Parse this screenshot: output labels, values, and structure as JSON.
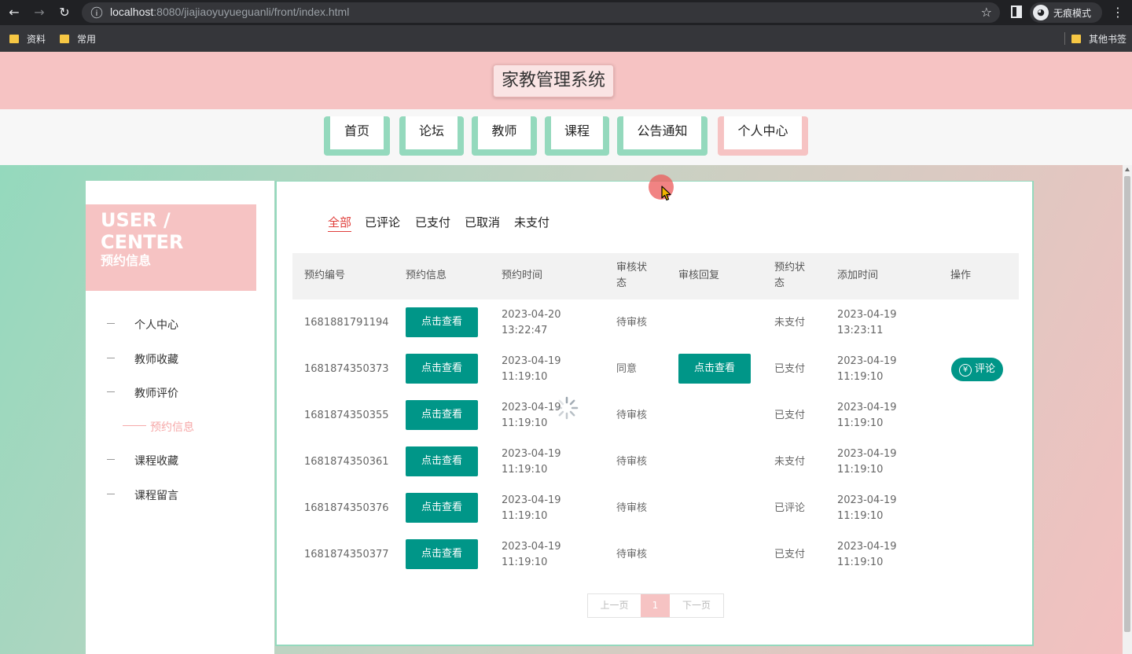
{
  "browser": {
    "url_host": "localhost",
    "url_rest": ":8080/jiajiaoyuyueguanli/front/index.html",
    "incognito_label": "无痕模式",
    "bookmarks": [
      "资料",
      "常用"
    ],
    "other_bookmarks": "其他书签"
  },
  "site": {
    "title": "家教管理系统"
  },
  "nav": [
    "首页",
    "论坛",
    "教师",
    "课程",
    "公告通知",
    "个人中心"
  ],
  "sidebar": {
    "en_title": "USER / CENTER",
    "cn_title": "预约信息",
    "items": [
      "个人中心",
      "教师收藏",
      "教师评价",
      "预约信息",
      "课程收藏",
      "课程留言"
    ],
    "active_index": 3
  },
  "tabs": [
    "全部",
    "已评论",
    "已支付",
    "已取消",
    "未支付"
  ],
  "table": {
    "headers": {
      "id": "预约编号",
      "info": "预约信息",
      "time": "预约时间",
      "audit_status_1": "审核状",
      "audit_status_2": "态",
      "audit_reply": "审核回复",
      "booking_status_1": "预约状",
      "booking_status_2": "态",
      "added": "添加时间",
      "ops": "操作"
    },
    "view_label": "点击查看",
    "comment_label": "评论",
    "yen_icon": "¥",
    "rows": [
      {
        "id": "1681881791194",
        "date": "2023-04-20",
        "time": "13:22:47",
        "audit": "待审核",
        "status": "未支付",
        "add_date": "2023-04-19",
        "add_time": "13:23:11"
      },
      {
        "id": "1681874350373",
        "date": "2023-04-19",
        "time": "11:19:10",
        "audit": "同意",
        "status": "已支付",
        "add_date": "2023-04-19",
        "add_time": "11:19:10"
      },
      {
        "id": "1681874350355",
        "date": "2023-04-19",
        "time": "11:19:10",
        "audit": "待审核",
        "status": "已支付",
        "add_date": "2023-04-19",
        "add_time": "11:19:10"
      },
      {
        "id": "1681874350361",
        "date": "2023-04-19",
        "time": "11:19:10",
        "audit": "待审核",
        "status": "未支付",
        "add_date": "2023-04-19",
        "add_time": "11:19:10"
      },
      {
        "id": "1681874350376",
        "date": "2023-04-19",
        "time": "11:19:10",
        "audit": "待审核",
        "status": "已评论",
        "add_date": "2023-04-19",
        "add_time": "11:19:10"
      },
      {
        "id": "1681874350377",
        "date": "2023-04-19",
        "time": "11:19:10",
        "audit": "待审核",
        "status": "已支付",
        "add_date": "2023-04-19",
        "add_time": "11:19:10"
      }
    ]
  },
  "pager": {
    "prev": "上一页",
    "current": "1",
    "next": "下一页"
  },
  "colors": {
    "pink": "#f6c3c3",
    "mint": "#94d9bd",
    "teal": "#009688",
    "active_tab": "#e0403c"
  }
}
